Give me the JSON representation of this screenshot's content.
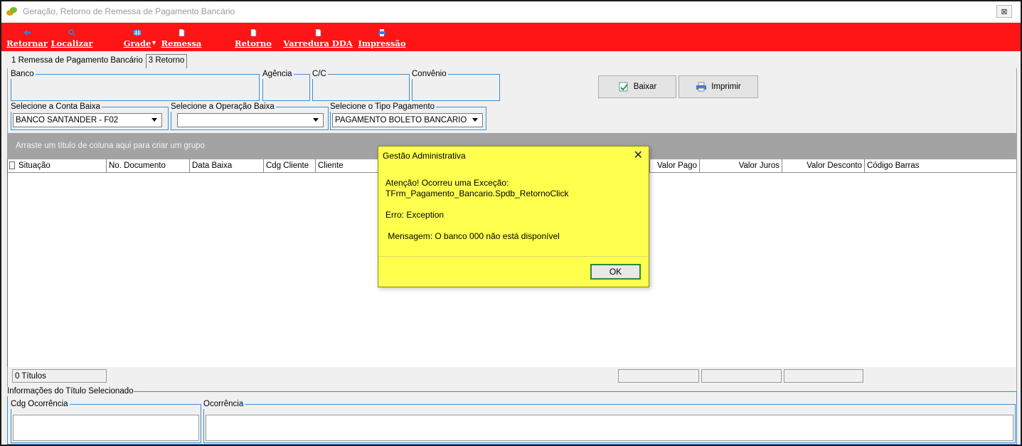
{
  "window": {
    "title": "Geração, Retorno de Remessa de Pagamento Bancário",
    "close_label": "⊠"
  },
  "toolbar": {
    "buttons": [
      {
        "label": "Retornar",
        "icon": "back-arrow-icon"
      },
      {
        "label": "Localizar",
        "icon": "magnifier-icon"
      },
      {
        "label": "Grade",
        "icon": "grid-icon"
      },
      {
        "label": "Remessa",
        "icon": "document-icon"
      },
      {
        "label": "Retorno",
        "icon": "document-icon"
      },
      {
        "label": "Varredura DDA",
        "icon": "document-icon"
      },
      {
        "label": "Impressão",
        "icon": "printer-icon"
      }
    ],
    "bg_color": "#ff1515"
  },
  "tabs": [
    {
      "label": "1 Remessa de Pagamento Bancário",
      "active": false
    },
    {
      "label": "3 Retorno",
      "active": true
    }
  ],
  "fields": {
    "banco_label": "Banco",
    "agencia_label": "Agência",
    "cc_label": "C/C",
    "convenio_label": "Convênio",
    "conta_baixa_label": "Selecione a Conta Baixa",
    "conta_baixa_value": "BANCO SANTANDER - F02",
    "operacao_baixa_label": "Selecione a Operação Baixa",
    "operacao_baixa_value": "",
    "tipo_pagamento_label": "Selecione o Tipo Pagamento",
    "tipo_pagamento_value": "PAGAMENTO BOLETO BANCARIO"
  },
  "actions": {
    "baixar_label": "Baixar",
    "imprimir_label": "Imprimir"
  },
  "grid": {
    "group_hint": "Arraste um título de coluna aqui para criar um grupo",
    "columns": [
      "Situação",
      "No. Documento",
      "Data Baixa",
      "Cdg Cliente",
      "Cliente",
      "Valor Pago",
      "Valor Juros",
      "Valor Desconto",
      "Código Barras"
    ],
    "count_label": "0 Títulos"
  },
  "info": {
    "group_label": "Informações do Título Selecionado",
    "cdg_ocorrencia_label": "Cdg Ocorrência",
    "ocorrencia_label": "Ocorrência"
  },
  "dialog": {
    "title": "Gestão Administrativa",
    "close": "✕",
    "lines": [
      "Atenção! Ocorreu uma Exceção:",
      "TFrm_Pagamento_Bancario.Spdb_RetornoClick",
      "",
      "Erro: Exception",
      "",
      " Mensagem: O banco 000 não está disponível"
    ],
    "ok_label": "OK",
    "bg_color": "#ffff4d"
  }
}
